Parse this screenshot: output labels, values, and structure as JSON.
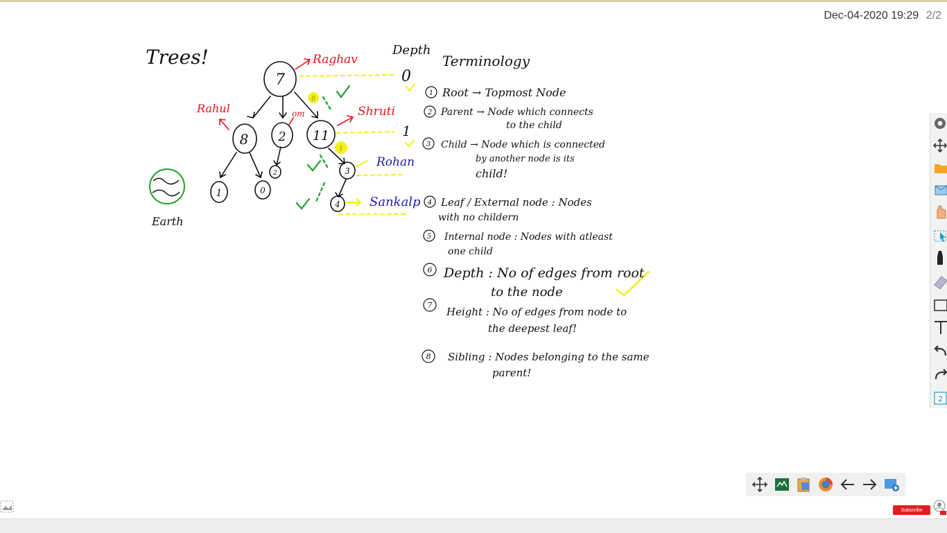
{
  "header": {
    "datetime": "Dec-04-2020 19:29",
    "page": "2/2"
  },
  "board": {
    "title": "Trees!",
    "tree_nodes": [
      "7",
      "8",
      "2",
      "11",
      "1",
      "0",
      "2",
      "3",
      "4"
    ],
    "name_labels": {
      "top": "Raghav",
      "left": "Rahul",
      "mid": "om",
      "right": "Shruti",
      "n3": "Rohan",
      "n4": "Sankalp"
    },
    "earth_label": "Earth",
    "depth_heading": "Depth",
    "depth_values": [
      "0",
      "1"
    ],
    "small_marks": [
      "0",
      "1"
    ],
    "terminology": {
      "heading": "Terminology",
      "items": [
        {
          "num": "1",
          "lines": [
            "Root → Topmost Node"
          ]
        },
        {
          "num": "2",
          "lines": [
            "Parent → Node which connects",
            "to the child"
          ]
        },
        {
          "num": "3",
          "lines": [
            "Child → Node which is connected",
            "by another node is its",
            "child!"
          ]
        },
        {
          "num": "4",
          "lines": [
            "Leaf / External node : Nodes",
            "with no childern"
          ]
        },
        {
          "num": "5",
          "lines": [
            "Internal node : Nodes with atleast",
            "one child"
          ]
        },
        {
          "num": "6",
          "lines": [
            "Depth : No of edges from root",
            "to the node"
          ]
        },
        {
          "num": "7",
          "lines": [
            "Height : No of edges from node to",
            "the deepest leaf!"
          ]
        },
        {
          "num": "8",
          "lines": [
            "Sibling : Nodes belonging to the same",
            "parent!"
          ]
        }
      ]
    }
  },
  "right_toolbar": {
    "tools": [
      "settings-icon",
      "move-icon",
      "folder-icon",
      "box-icon",
      "hand-icon",
      "select-arrow-icon",
      "pen-icon",
      "eraser-icon",
      "rectangle-icon",
      "text-icon",
      "undo-icon",
      "redo-icon",
      "page-number-icon"
    ],
    "page_badge": "2"
  },
  "bottom_toolbar": {
    "tools": [
      "move-icon",
      "whiteboard-icon",
      "clipboard-icon",
      "browser-icon",
      "prev-page-icon",
      "next-page-icon",
      "add-page-icon"
    ]
  },
  "subscribe_label": "Subscribe",
  "colors": {
    "ink": "#111111",
    "red": "#e0141e",
    "green": "#1e9e2a",
    "yellow": "#f2ee1c",
    "blue": "#1a1aa8"
  }
}
